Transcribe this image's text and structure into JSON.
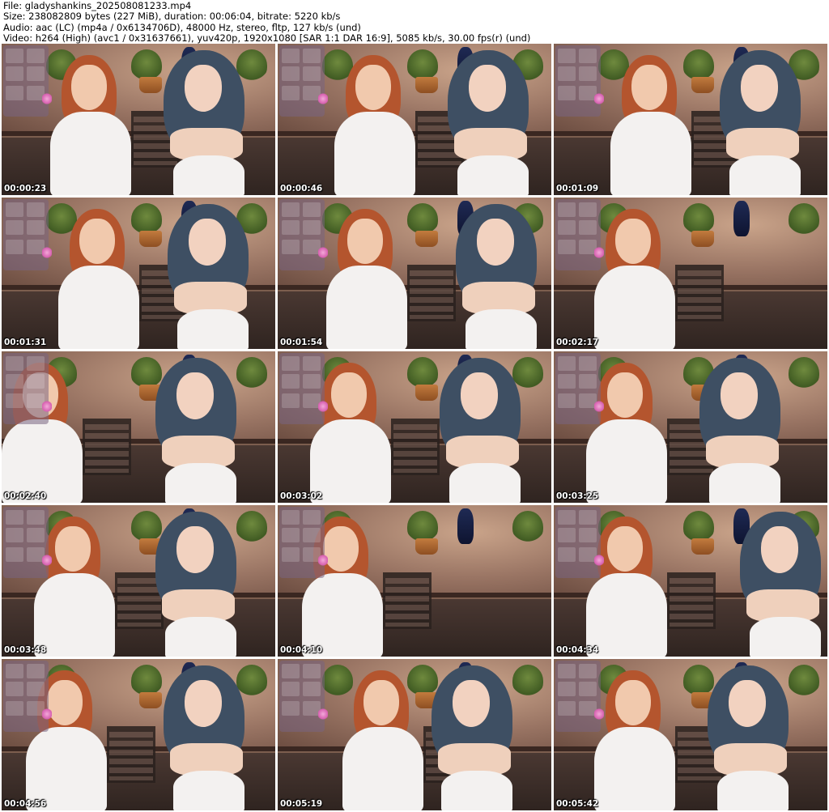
{
  "header": {
    "file_line": "File: gladyshankins_202508081233.mp4",
    "size_line": "Size: 238082809 bytes (227 MiB), duration: 00:06:04, bitrate: 5220 kb/s",
    "audio_line": "Audio: aac (LC) (mp4a / 0x6134706D), 48000 Hz, stereo, fltp, 127 kb/s (und)",
    "video_line": "Video: h264 (High) (avc1 / 0x31637661), yuv420p, 1920x1080 [SAR 1:1 DAR 16:9], 5085 kb/s, 30.00 fps(r) (und)"
  },
  "thumbnails": [
    {
      "timestamp": "00:00:23"
    },
    {
      "timestamp": "00:00:46"
    },
    {
      "timestamp": "00:01:09"
    },
    {
      "timestamp": "00:01:31"
    },
    {
      "timestamp": "00:01:54"
    },
    {
      "timestamp": "00:02:17"
    },
    {
      "timestamp": "00:02:40"
    },
    {
      "timestamp": "00:03:02"
    },
    {
      "timestamp": "00:03:25"
    },
    {
      "timestamp": "00:03:48"
    },
    {
      "timestamp": "00:04:10"
    },
    {
      "timestamp": "00:04:34"
    },
    {
      "timestamp": "00:04:56"
    },
    {
      "timestamp": "00:05:19"
    },
    {
      "timestamp": "00:05:42"
    }
  ],
  "colors": {
    "hair_red": "#b4552e",
    "hair_blue": "#3e4f63",
    "top_white": "#f3f1f0"
  }
}
